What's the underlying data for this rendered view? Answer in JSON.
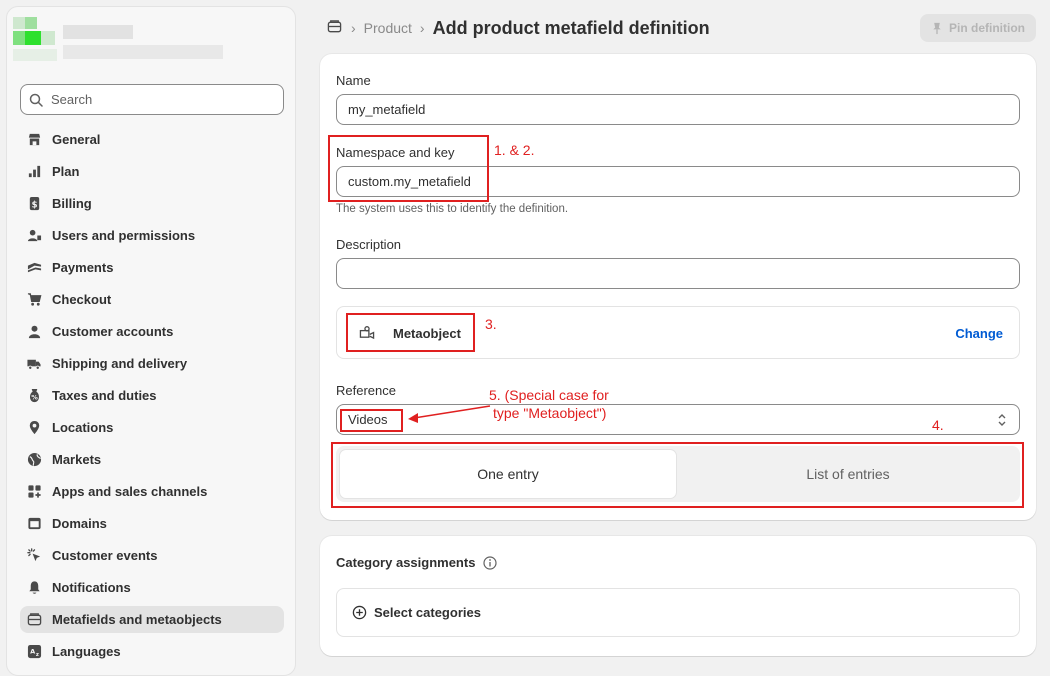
{
  "sidebar": {
    "search_placeholder": "Search",
    "items": [
      {
        "label": "General",
        "icon": "store-icon"
      },
      {
        "label": "Plan",
        "icon": "plan-icon"
      },
      {
        "label": "Billing",
        "icon": "billing-icon"
      },
      {
        "label": "Users and permissions",
        "icon": "users-icon"
      },
      {
        "label": "Payments",
        "icon": "payments-icon"
      },
      {
        "label": "Checkout",
        "icon": "cart-icon"
      },
      {
        "label": "Customer accounts",
        "icon": "person-icon"
      },
      {
        "label": "Shipping and delivery",
        "icon": "truck-icon"
      },
      {
        "label": "Taxes and duties",
        "icon": "tax-icon"
      },
      {
        "label": "Locations",
        "icon": "location-icon"
      },
      {
        "label": "Markets",
        "icon": "globe-icon"
      },
      {
        "label": "Apps and sales channels",
        "icon": "apps-icon"
      },
      {
        "label": "Domains",
        "icon": "domain-icon"
      },
      {
        "label": "Customer events",
        "icon": "cursor-icon"
      },
      {
        "label": "Notifications",
        "icon": "bell-icon"
      },
      {
        "label": "Metafields and metaobjects",
        "icon": "metafields-icon"
      },
      {
        "label": "Languages",
        "icon": "language-icon"
      }
    ]
  },
  "header": {
    "breadcrumb": "Product",
    "title": "Add product metafield definition",
    "pin_label": "Pin definition"
  },
  "form": {
    "name_label": "Name",
    "name_value": "my_metafield",
    "ns_label": "Namespace and key",
    "ns_value": "custom.my_metafield",
    "ns_help": "The system uses this to identify the definition.",
    "desc_label": "Description",
    "desc_value": "",
    "type_label": "Metaobject",
    "change_label": "Change",
    "ref_label": "Reference",
    "ref_value": "Videos",
    "one_entry": "One entry",
    "list_entries": "List of entries"
  },
  "categories": {
    "title": "Category assignments",
    "select_label": "Select categories"
  },
  "annotations": {
    "a12": "1. & 2.",
    "a3": "3.",
    "a4": "4.",
    "a5_line1": "5. (Special case for",
    "a5_line2": "type \"Metaobject\")"
  },
  "colors": {
    "accent": "#005bd3",
    "annotation": "#e02020"
  }
}
